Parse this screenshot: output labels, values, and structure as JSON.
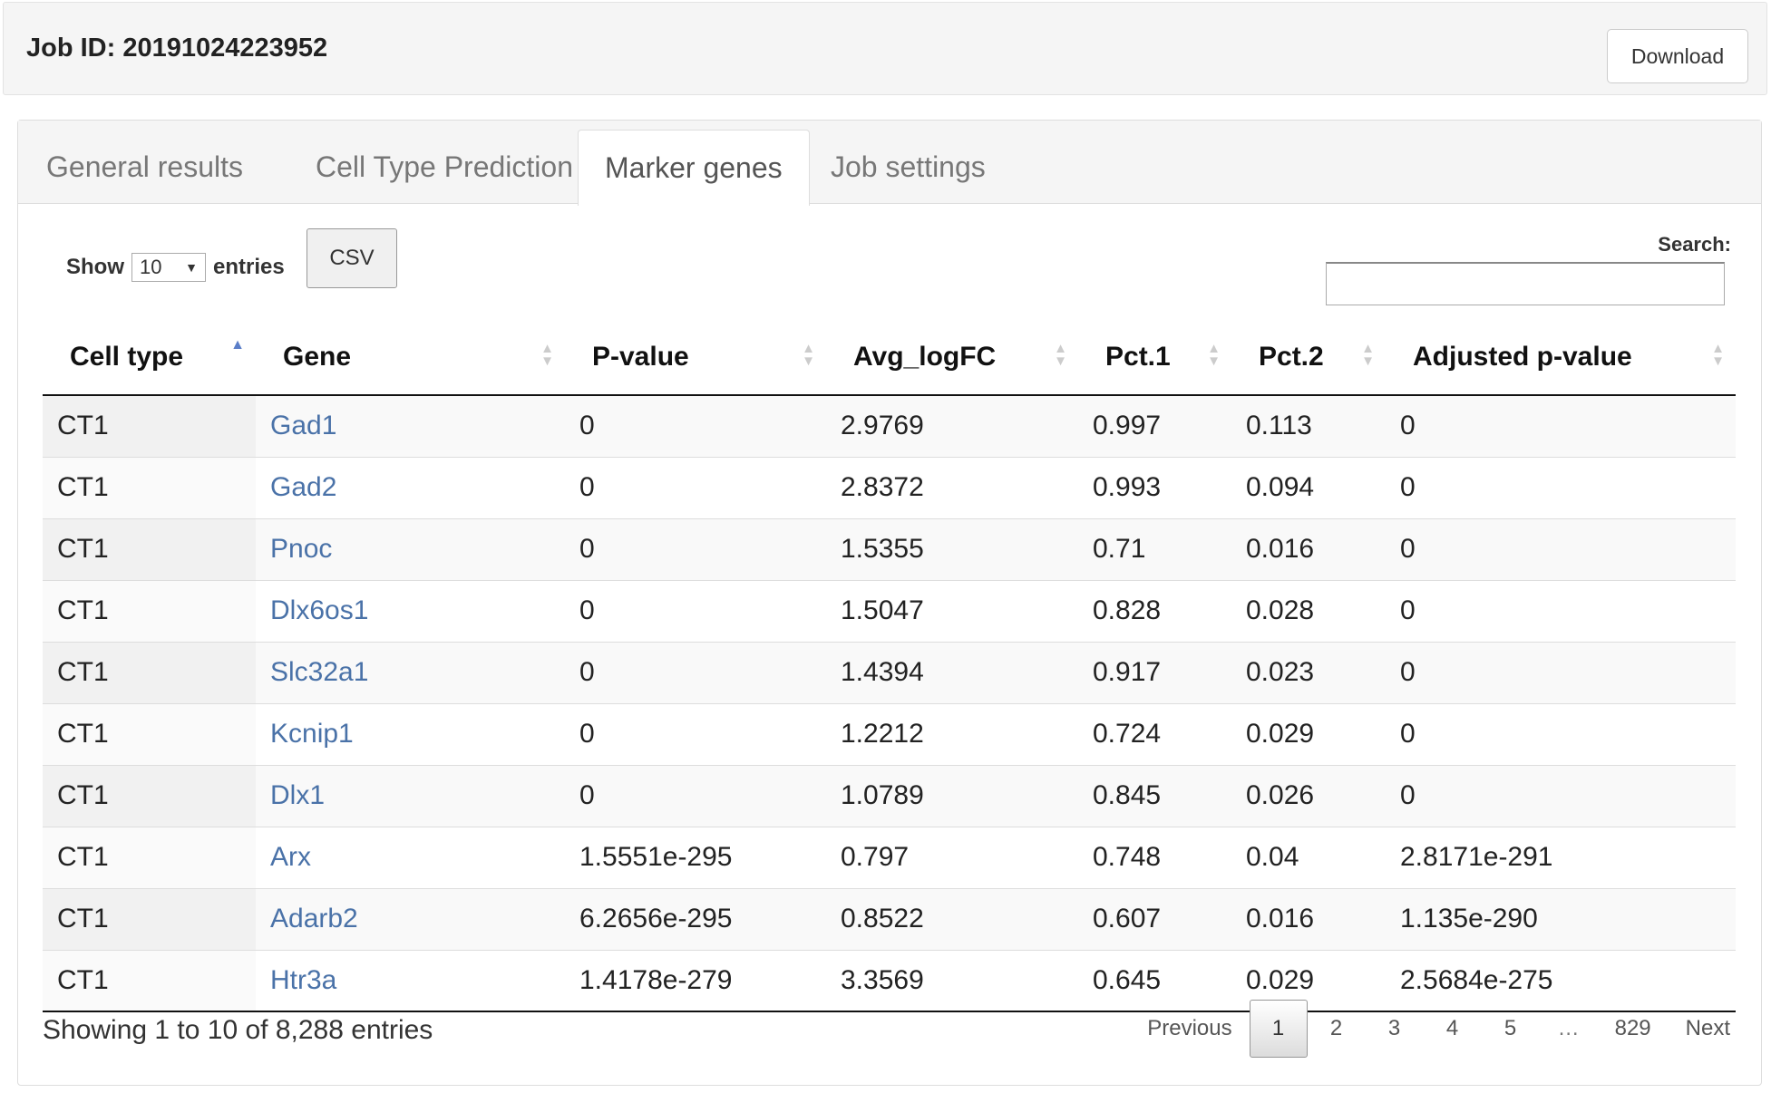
{
  "header": {
    "job_title": "Job ID: 20191024223952",
    "download_label": "Download"
  },
  "tabs": [
    {
      "label": "General results",
      "active": false
    },
    {
      "label": "Cell Type Prediction",
      "active": false
    },
    {
      "label": "Marker genes",
      "active": true
    },
    {
      "label": "Job settings",
      "active": false
    }
  ],
  "controls": {
    "show_label": "Show",
    "entries_value": "10",
    "entries_label": "entries",
    "csv_label": "CSV",
    "search_label": "Search:",
    "search_value": ""
  },
  "table": {
    "columns": [
      "Cell type",
      "Gene",
      "P-value",
      "Avg_logFC",
      "Pct.1",
      "Pct.2",
      "Adjusted p-value"
    ],
    "sorted_column": "Cell type",
    "sort_direction": "ascending",
    "rows": [
      [
        "CT1",
        "Gad1",
        "0",
        "2.9769",
        "0.997",
        "0.113",
        "0"
      ],
      [
        "CT1",
        "Gad2",
        "0",
        "2.8372",
        "0.993",
        "0.094",
        "0"
      ],
      [
        "CT1",
        "Pnoc",
        "0",
        "1.5355",
        "0.71",
        "0.016",
        "0"
      ],
      [
        "CT1",
        "Dlx6os1",
        "0",
        "1.5047",
        "0.828",
        "0.028",
        "0"
      ],
      [
        "CT1",
        "Slc32a1",
        "0",
        "1.4394",
        "0.917",
        "0.023",
        "0"
      ],
      [
        "CT1",
        "Kcnip1",
        "0",
        "1.2212",
        "0.724",
        "0.029",
        "0"
      ],
      [
        "CT1",
        "Dlx1",
        "0",
        "1.0789",
        "0.845",
        "0.026",
        "0"
      ],
      [
        "CT1",
        "Arx",
        "1.5551e-295",
        "0.797",
        "0.748",
        "0.04",
        "2.8171e-291"
      ],
      [
        "CT1",
        "Adarb2",
        "6.2656e-295",
        "0.8522",
        "0.607",
        "0.016",
        "1.135e-290"
      ],
      [
        "CT1",
        "Htr3a",
        "1.4178e-279",
        "3.3569",
        "0.645",
        "0.029",
        "2.5684e-275"
      ]
    ]
  },
  "footer": {
    "info": "Showing 1 to 10 of 8,288 entries",
    "previous_label": "Previous",
    "pages": [
      "1",
      "2",
      "3",
      "4",
      "5"
    ],
    "ellipsis": "…",
    "last_page": "829",
    "next_label": "Next",
    "current_page": "1"
  },
  "colors": {
    "link": "#4a72a8",
    "sort_active": "#5b7ec8"
  }
}
